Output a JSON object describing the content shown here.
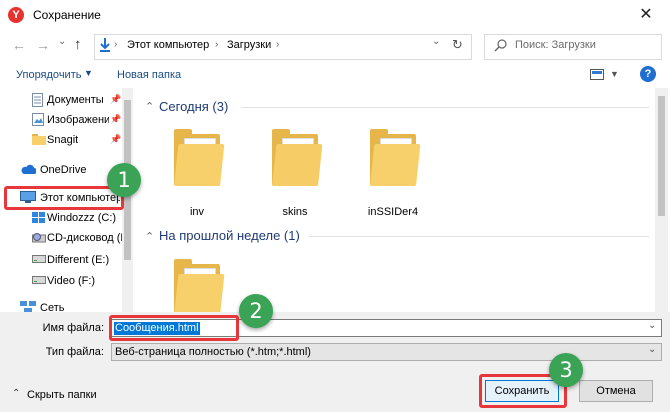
{
  "window": {
    "title": "Сохранение",
    "app_icon_glyph": "Y",
    "close_glyph": "✕"
  },
  "address": {
    "back_glyph": "←",
    "forward_glyph": "→",
    "history_glyph": "⌄",
    "up_glyph": "↑",
    "crumbs": [
      "Этот компьютер",
      "Загрузки"
    ],
    "separator": "›",
    "refresh_glyph": "↻"
  },
  "search": {
    "placeholder": "Поиск: Загрузки"
  },
  "toolbar": {
    "organize_label": "Упорядочить",
    "new_folder_label": "Новая папка",
    "help_glyph": "?"
  },
  "sidebar": {
    "items": [
      {
        "label": "Документы",
        "icon": "document-icon",
        "pinned": true
      },
      {
        "label": "Изображени",
        "icon": "image-icon",
        "pinned": true
      },
      {
        "label": "Snagit",
        "icon": "folder-icon",
        "pinned": true
      },
      {
        "label": "OneDrive",
        "icon": "cloud-icon",
        "pinned": false
      },
      {
        "label": "Этот компьютер",
        "icon": "computer-icon",
        "pinned": false
      },
      {
        "label": "Windozzz (C:)",
        "icon": "drive-icon",
        "pinned": false
      },
      {
        "label": "CD-дисковод (D",
        "icon": "cd-drive-icon",
        "pinned": false
      },
      {
        "label": "Different (E:)",
        "icon": "drive-icon",
        "pinned": false
      },
      {
        "label": "Video (F:)",
        "icon": "drive-icon",
        "pinned": false
      },
      {
        "label": "Сеть",
        "icon": "network-icon",
        "pinned": false
      }
    ]
  },
  "groups": [
    {
      "header": "Сегодня (3)",
      "files": [
        "inv",
        "skins",
        "inSSIDer4"
      ]
    },
    {
      "header": "На прошлой неделе (1)",
      "files": [
        ""
      ]
    }
  ],
  "form": {
    "filename_label": "Имя файла:",
    "filename_value": "Сообщения.html",
    "filetype_label": "Тип файла:",
    "filetype_value": "Веб-страница полностью (*.htm;*.html)"
  },
  "footer": {
    "hide_folders_label": "Скрыть папки",
    "save_label": "Сохранить",
    "cancel_label": "Отмена"
  },
  "annotations": {
    "step1": "1",
    "step2": "2",
    "step3": "3"
  },
  "colors": {
    "accent": "#0078d7",
    "highlight_red": "#e8373a",
    "badge_green": "#3aa356",
    "folder_yellow": "#f7d06b"
  }
}
